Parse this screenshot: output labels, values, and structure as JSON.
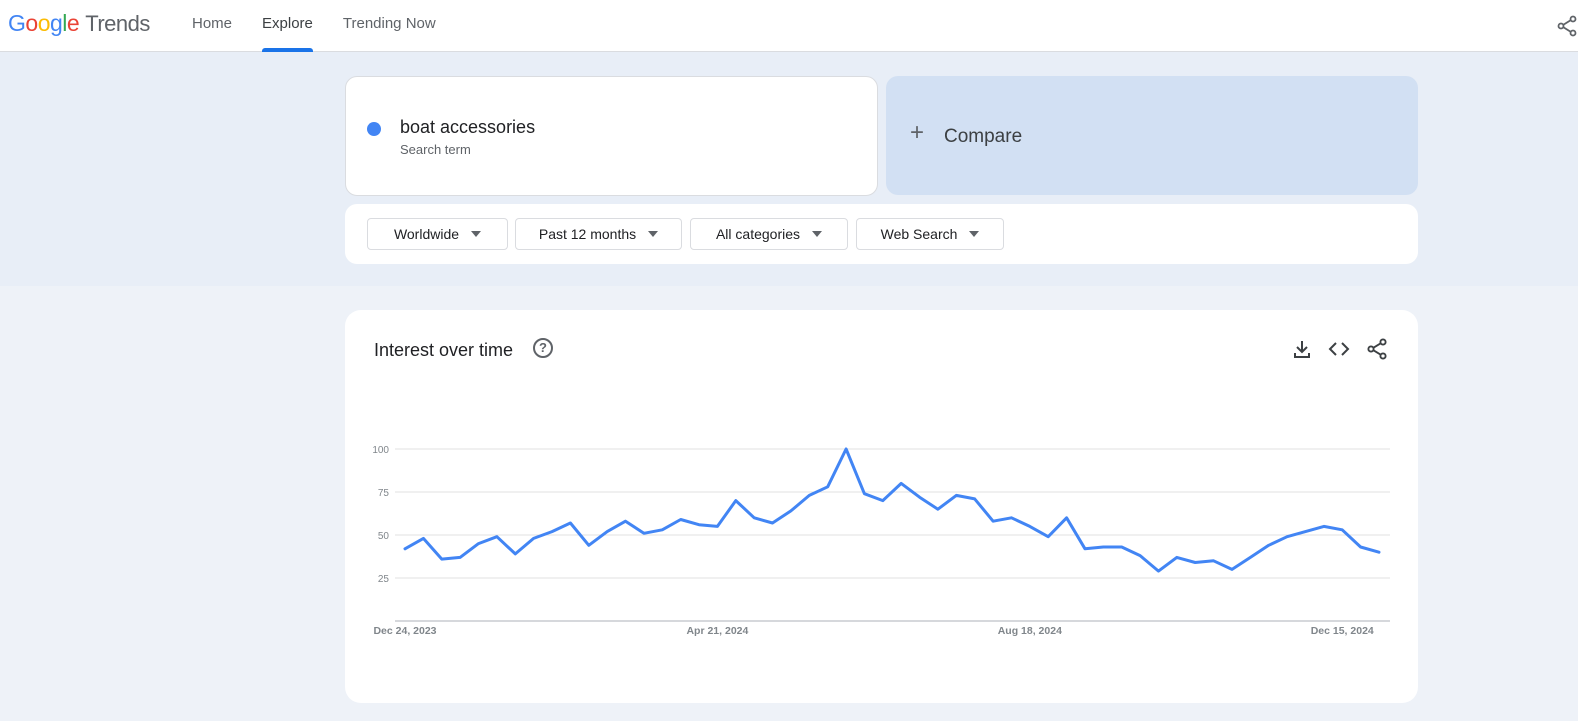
{
  "header": {
    "logo_google": "Google",
    "logo_product": "Trends",
    "nav": [
      "Home",
      "Explore",
      "Trending Now"
    ],
    "active_nav": "Explore"
  },
  "search": {
    "term": "boat accessories",
    "term_type": "Search term",
    "term_color": "#4285f4",
    "compare_label": "Compare"
  },
  "filters": {
    "region": "Worldwide",
    "time_range": "Past 12 months",
    "category": "All categories",
    "property": "Web Search"
  },
  "chart": {
    "title": "Interest over time",
    "actions": [
      "download-icon",
      "embed-icon",
      "share-icon"
    ]
  },
  "chart_data": {
    "type": "line",
    "series": [
      {
        "name": "boat accessories",
        "color": "#4285f4",
        "values": [
          42,
          48,
          36,
          37,
          45,
          49,
          39,
          48,
          52,
          57,
          44,
          52,
          58,
          51,
          53,
          59,
          56,
          55,
          70,
          60,
          57,
          64,
          73,
          78,
          100,
          74,
          70,
          80,
          72,
          65,
          73,
          71,
          58,
          60,
          55,
          49,
          60,
          42,
          43,
          43,
          38,
          29,
          37,
          34,
          35,
          30,
          37,
          44,
          49,
          52,
          55,
          53,
          43,
          40
        ]
      }
    ],
    "x_tick_labels": [
      "Dec 24, 2023",
      "Apr 21, 2024",
      "Aug 18, 2024",
      "Dec 15, 2024"
    ],
    "x_tick_indices": [
      0,
      17,
      34,
      51
    ],
    "y_ticks": [
      25,
      50,
      75,
      100
    ],
    "ylim": [
      0,
      100
    ],
    "grid": true
  }
}
